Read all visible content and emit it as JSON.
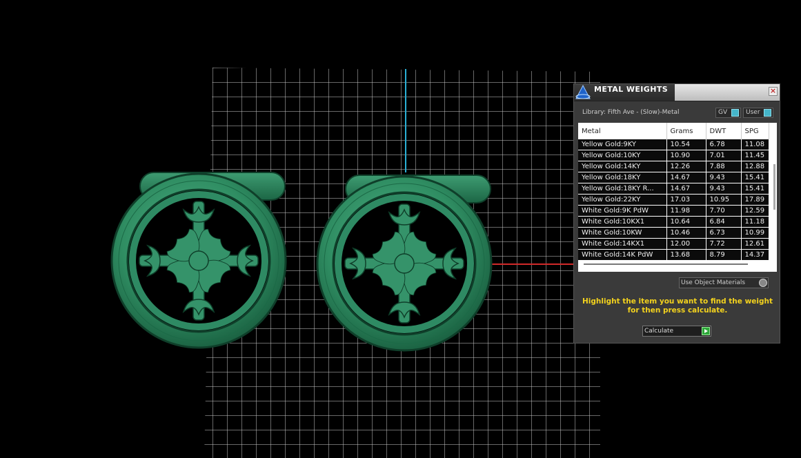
{
  "panel": {
    "title": "METAL WEIGHTS",
    "close_label": "×",
    "library": "Library: Fifth Ave - (Slow)-Metal",
    "gv_label": "GV",
    "user_label": "User",
    "columns": [
      "Metal",
      "Grams",
      "DWT",
      "SPG"
    ],
    "rows": [
      [
        "Yellow Gold:9KY",
        "10.54",
        "6.78",
        "11.08"
      ],
      [
        "Yellow Gold:10KY",
        "10.90",
        "7.01",
        "11.45"
      ],
      [
        "Yellow Gold:14KY",
        "12.26",
        "7.88",
        "12.88"
      ],
      [
        "Yellow Gold:18KY",
        "14.67",
        "9.43",
        "15.41"
      ],
      [
        "Yellow Gold:18KY R...",
        "14.67",
        "9.43",
        "15.41"
      ],
      [
        "Yellow Gold:22KY",
        "17.03",
        "10.95",
        "17.89"
      ],
      [
        "White Gold:9K PdW",
        "11.98",
        "7.70",
        "12.59"
      ],
      [
        "White Gold:10KX1",
        "10.64",
        "6.84",
        "11.18"
      ],
      [
        "White Gold:10KW",
        "10.46",
        "6.73",
        "10.99"
      ],
      [
        "White Gold:14KX1",
        "12.00",
        "7.72",
        "12.61"
      ],
      [
        "White Gold:14K PdW",
        "13.68",
        "8.79",
        "14.37"
      ]
    ],
    "use_object_materials": "Use Object Materials",
    "instruction": "Highlight the item you want to find the weight for then press calculate.",
    "calculate_label": "Calculate"
  },
  "colors": {
    "background": "#000000",
    "model_green": "#2e8a63",
    "grid": "#d8d8d8",
    "axis_x": "#d22a2a",
    "axis_y": "#2ab0d6",
    "highlight_text": "#f3d21d"
  }
}
